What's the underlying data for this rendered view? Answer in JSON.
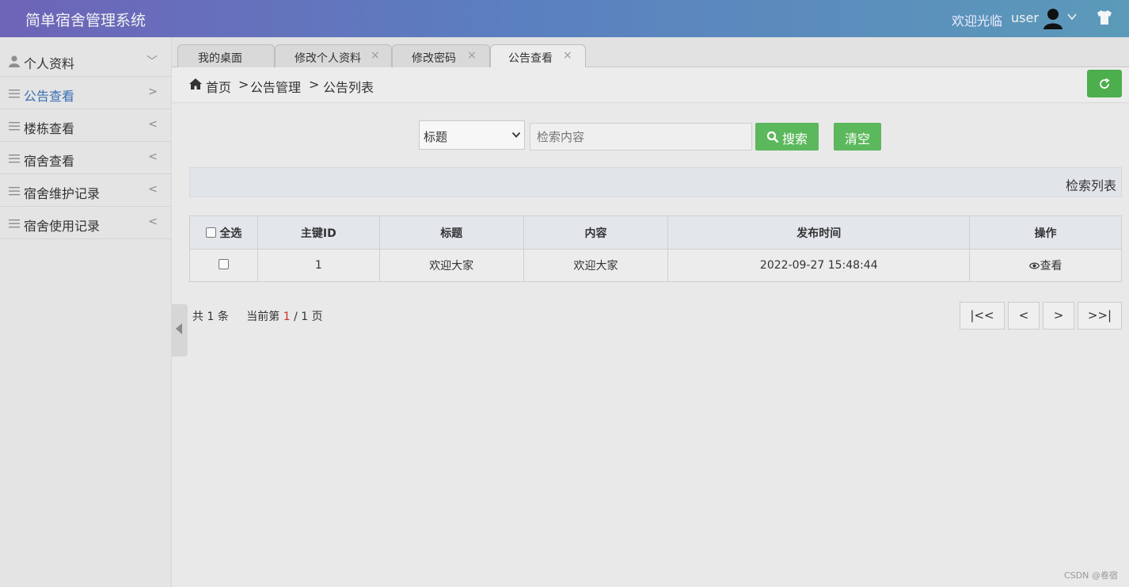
{
  "header": {
    "app_title": "简单宿舍管理系统",
    "welcome": "欢迎光临",
    "username": "user",
    "user_icon": "user-icon",
    "menu_icon": "chevron-down-icon",
    "theme_icon": "shirt-icon",
    "gradient": [
      "#6e64b8",
      "#5b9ab9"
    ]
  },
  "sidebar": {
    "items": [
      {
        "label": "个人资料",
        "icon": "user-icon",
        "arrow": "﹀"
      },
      {
        "label": "公告查看",
        "icon": "list-icon",
        "arrow": ">",
        "active": true
      },
      {
        "label": "楼栋查看",
        "icon": "list-icon",
        "arrow": "<"
      },
      {
        "label": "宿舍查看",
        "icon": "list-icon",
        "arrow": "<"
      },
      {
        "label": "宿舍维护记录",
        "icon": "list-icon",
        "arrow": "<"
      },
      {
        "label": "宿舍使用记录",
        "icon": "list-icon",
        "arrow": "<"
      }
    ]
  },
  "tabs": [
    {
      "label": "我的桌面",
      "closable": false
    },
    {
      "label": "修改个人资料",
      "close": "×"
    },
    {
      "label": "修改密码",
      "close": "×"
    },
    {
      "label": "公告查看",
      "close": "×",
      "active": true
    }
  ],
  "breadcrumb": {
    "home": "首页",
    "sep1": ">",
    "level2": "公告管理",
    "sep2": ">",
    "level3": "公告列表"
  },
  "search": {
    "field_selected": "标题",
    "placeholder": "检索内容",
    "search_label": "搜索",
    "clear_label": "清空"
  },
  "list_title": "检索列表",
  "table": {
    "columns": [
      "全选",
      "主键ID",
      "标题",
      "内容",
      "发布时间",
      "操作"
    ],
    "rows": [
      {
        "id": "1",
        "title": "欢迎大家",
        "content": "欢迎大家",
        "time": "2022-09-27 15:48:44",
        "action": "查看"
      }
    ]
  },
  "pagination": {
    "total_prefix": "共",
    "total": "1",
    "total_suffix": "条",
    "current_prefix": "当前第",
    "current": "1",
    "pages": "/ 1 页",
    "first": "|<<",
    "prev": "<",
    "next": ">",
    "last": ">>|"
  },
  "watermark": "CSDN @卷宿",
  "colors": {
    "accent": "#5cb85c",
    "active_link": "#3a6fb4"
  }
}
